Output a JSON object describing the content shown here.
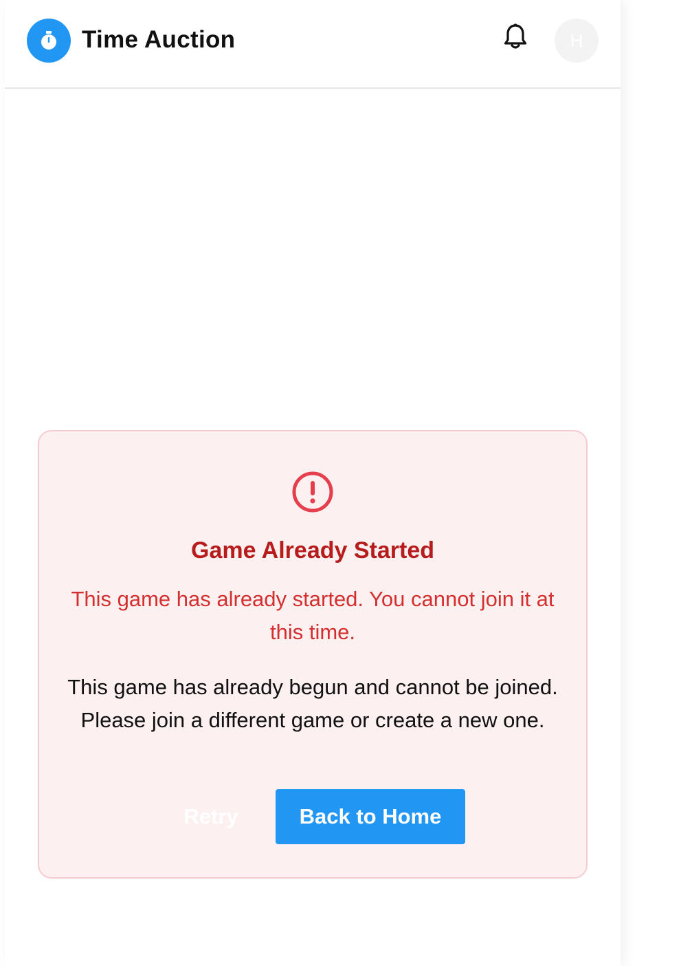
{
  "header": {
    "app_title": "Time Auction",
    "logo_icon": "stopwatch-icon",
    "notification_icon": "bell-icon",
    "avatar_initial": "H"
  },
  "error": {
    "icon": "alert-circle-icon",
    "title": "Game Already Started",
    "message": "This game has already started. You cannot join it at this time.",
    "detail": "This game has already begun and cannot be joined. Please join a different game or create a new one.",
    "retry_label": "Retry",
    "home_label": "Back to Home"
  },
  "colors": {
    "primary": "#2196f3",
    "error_title": "#b71c1c",
    "error_text": "#d32f2f",
    "error_icon": "#e53e4d",
    "card_background": "#fdf0f1",
    "card_border": "#f6cbcf"
  }
}
